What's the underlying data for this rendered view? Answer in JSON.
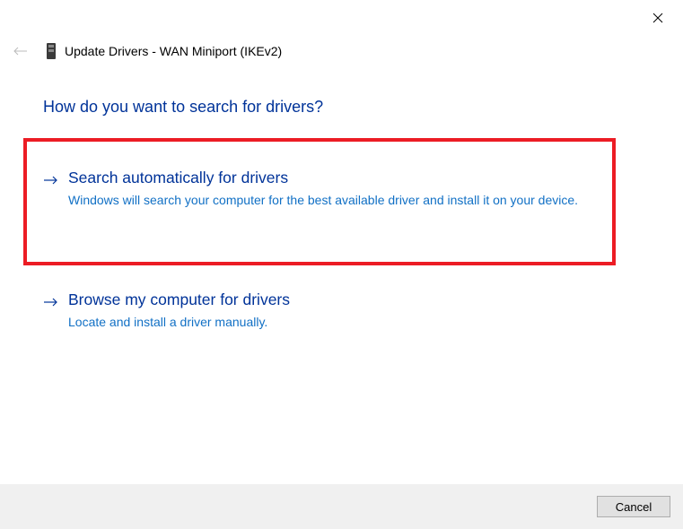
{
  "window": {
    "title": "Update Drivers - WAN Miniport (IKEv2)"
  },
  "heading": "How do you want to search for drivers?",
  "options": [
    {
      "title": "Search automatically for drivers",
      "description": "Windows will search your computer for the best available driver and install it on your device."
    },
    {
      "title": "Browse my computer for drivers",
      "description": "Locate and install a driver manually."
    }
  ],
  "footer": {
    "cancel_label": "Cancel"
  }
}
